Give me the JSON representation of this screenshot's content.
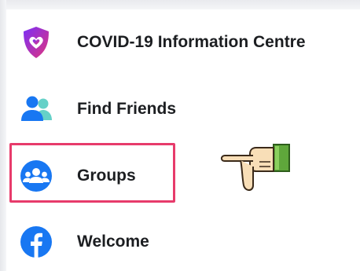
{
  "menu": {
    "items": [
      {
        "label": "COVID-19 Information Centre",
        "icon": "shield-heart-icon"
      },
      {
        "label": "Find Friends",
        "icon": "people-icon"
      },
      {
        "label": "Groups",
        "icon": "groups-icon"
      },
      {
        "label": "Welcome",
        "icon": "facebook-logo-icon"
      }
    ]
  },
  "colors": {
    "covid_purple": "#8a2be2",
    "covid_pink": "#e13a8a",
    "friends_blue": "#1877f2",
    "friends_teal": "#65d1c8",
    "highlight_border": "#e73b6b",
    "text": "#1c1e21"
  },
  "annotation": {
    "pointer_icon": "pointing-hand-icon"
  }
}
